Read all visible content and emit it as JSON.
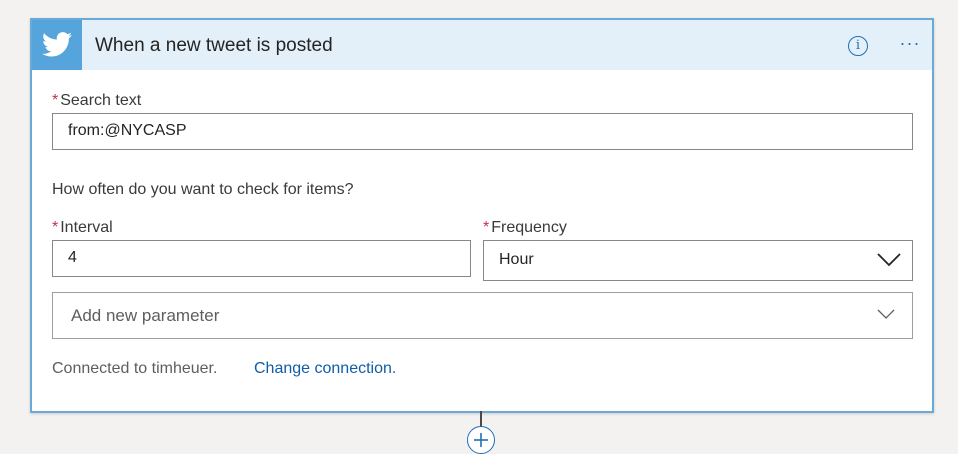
{
  "trigger": {
    "title": "When a new tweet is posted",
    "icon": "twitter-bird-icon",
    "accent_color": "#55a4dc",
    "header_bg": "#e3f0fa",
    "info_icon_glyph": "i",
    "more_glyph": "···"
  },
  "form": {
    "required_marker": "*",
    "search_text": {
      "label": "Search text",
      "value": "from:@NYCASP"
    },
    "prompt": "How often do you want to check for items?",
    "interval": {
      "label": "Interval",
      "value": "4"
    },
    "frequency": {
      "label": "Frequency",
      "selected": "Hour"
    },
    "add_parameter": {
      "placeholder": "Add new parameter"
    }
  },
  "connection": {
    "text": "Connected to timheuer.",
    "link": "Change connection."
  }
}
